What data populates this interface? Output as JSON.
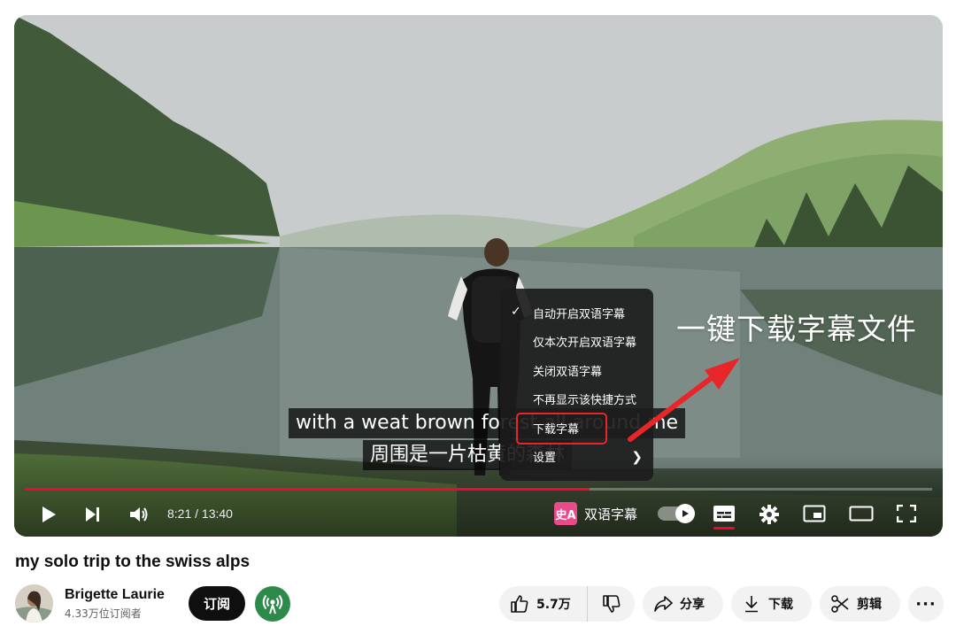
{
  "player": {
    "subtitle_en": "with a weat brown forest all around me",
    "subtitle_zh": "周围是一片枯黄的森林",
    "time_display": "8:21 / 13:40",
    "progress_fraction": 0.6225,
    "bilingual_label": "双语字幕",
    "bilingual_badge": "史A",
    "accent_color": "#ff0033"
  },
  "menu": {
    "items": [
      {
        "label": "自动开启双语字幕",
        "checked": true
      },
      {
        "label": "仅本次开启双语字幕"
      },
      {
        "label": "关闭双语字幕"
      },
      {
        "label": "不再显示该快捷方式"
      },
      {
        "label": "下载字幕",
        "highlighted": true
      },
      {
        "label": "设置",
        "submenu": true
      }
    ],
    "highlight_color": "#e8262a"
  },
  "annotation": {
    "text": "一键下载字幕文件"
  },
  "video": {
    "title": "my solo trip to the swiss alps"
  },
  "channel": {
    "name": "Brigette Laurie",
    "subscribers": "4.33万位订阅者",
    "subscribe_label": "订阅"
  },
  "actions": {
    "like_count": "5.7万",
    "share_label": "分享",
    "download_label": "下载",
    "clip_label": "剪辑",
    "more_label": "···"
  }
}
